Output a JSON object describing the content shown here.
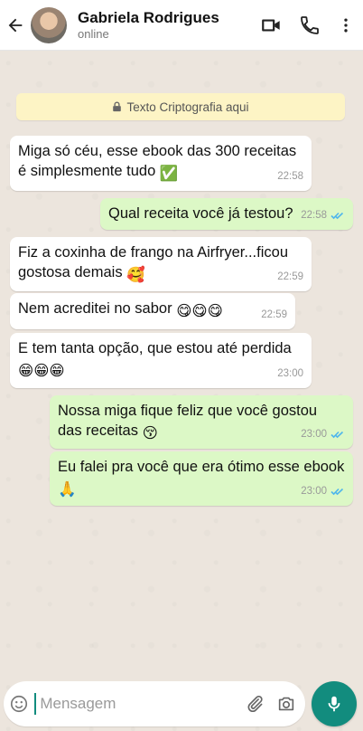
{
  "header": {
    "contact_name": "Gabriela Rodrigues",
    "status": "online",
    "icons": [
      "back-arrow-icon",
      "video-call-icon",
      "phone-icon",
      "more-vert-icon"
    ]
  },
  "encryption_notice": "Texto Criptografia aqui",
  "messages": [
    {
      "direction": "in",
      "lines": [
        "Miga só céu, esse ebook das 300 receitas",
        "é simplesmente tudo"
      ],
      "emoji": "✅",
      "time": "22:58"
    },
    {
      "direction": "out",
      "lines": [
        "Qual receita você já testou?"
      ],
      "time": "22:58",
      "read": true
    },
    {
      "direction": "in",
      "lines": [
        "Fiz a coxinha de frango na Airfryer...ficou",
        "gostosa demais"
      ],
      "emoji": "🥰",
      "time": "22:59"
    },
    {
      "direction": "in",
      "lines": [
        "Nem acreditei no sabor"
      ],
      "emoji": "😋😋😋",
      "time": "22:59"
    },
    {
      "direction": "in",
      "lines": [
        "E tem tanta opção, que estou até perdida"
      ],
      "emoji": "😁😁😁",
      "time": "23:00"
    },
    {
      "direction": "out",
      "lines": [
        "Nossa miga fique feliz que você gostou",
        "das receitas"
      ],
      "emoji": "😚",
      "time": "23:00",
      "read": true
    },
    {
      "direction": "out",
      "lines": [
        "Eu falei pra você que era ótimo esse ebook"
      ],
      "emoji": "🙏",
      "time": "23:00",
      "read": true
    }
  ],
  "composer": {
    "placeholder": "Mensagem",
    "icons": [
      "emoji-icon",
      "attach-icon",
      "camera-icon",
      "mic-icon"
    ]
  },
  "colors": {
    "accent": "#128c7e",
    "outgoing_bubble": "#dcf8c6",
    "incoming_bubble": "#ffffff",
    "read_ticks": "#4fb6ec",
    "notice_bg": "#fdf4c5"
  }
}
